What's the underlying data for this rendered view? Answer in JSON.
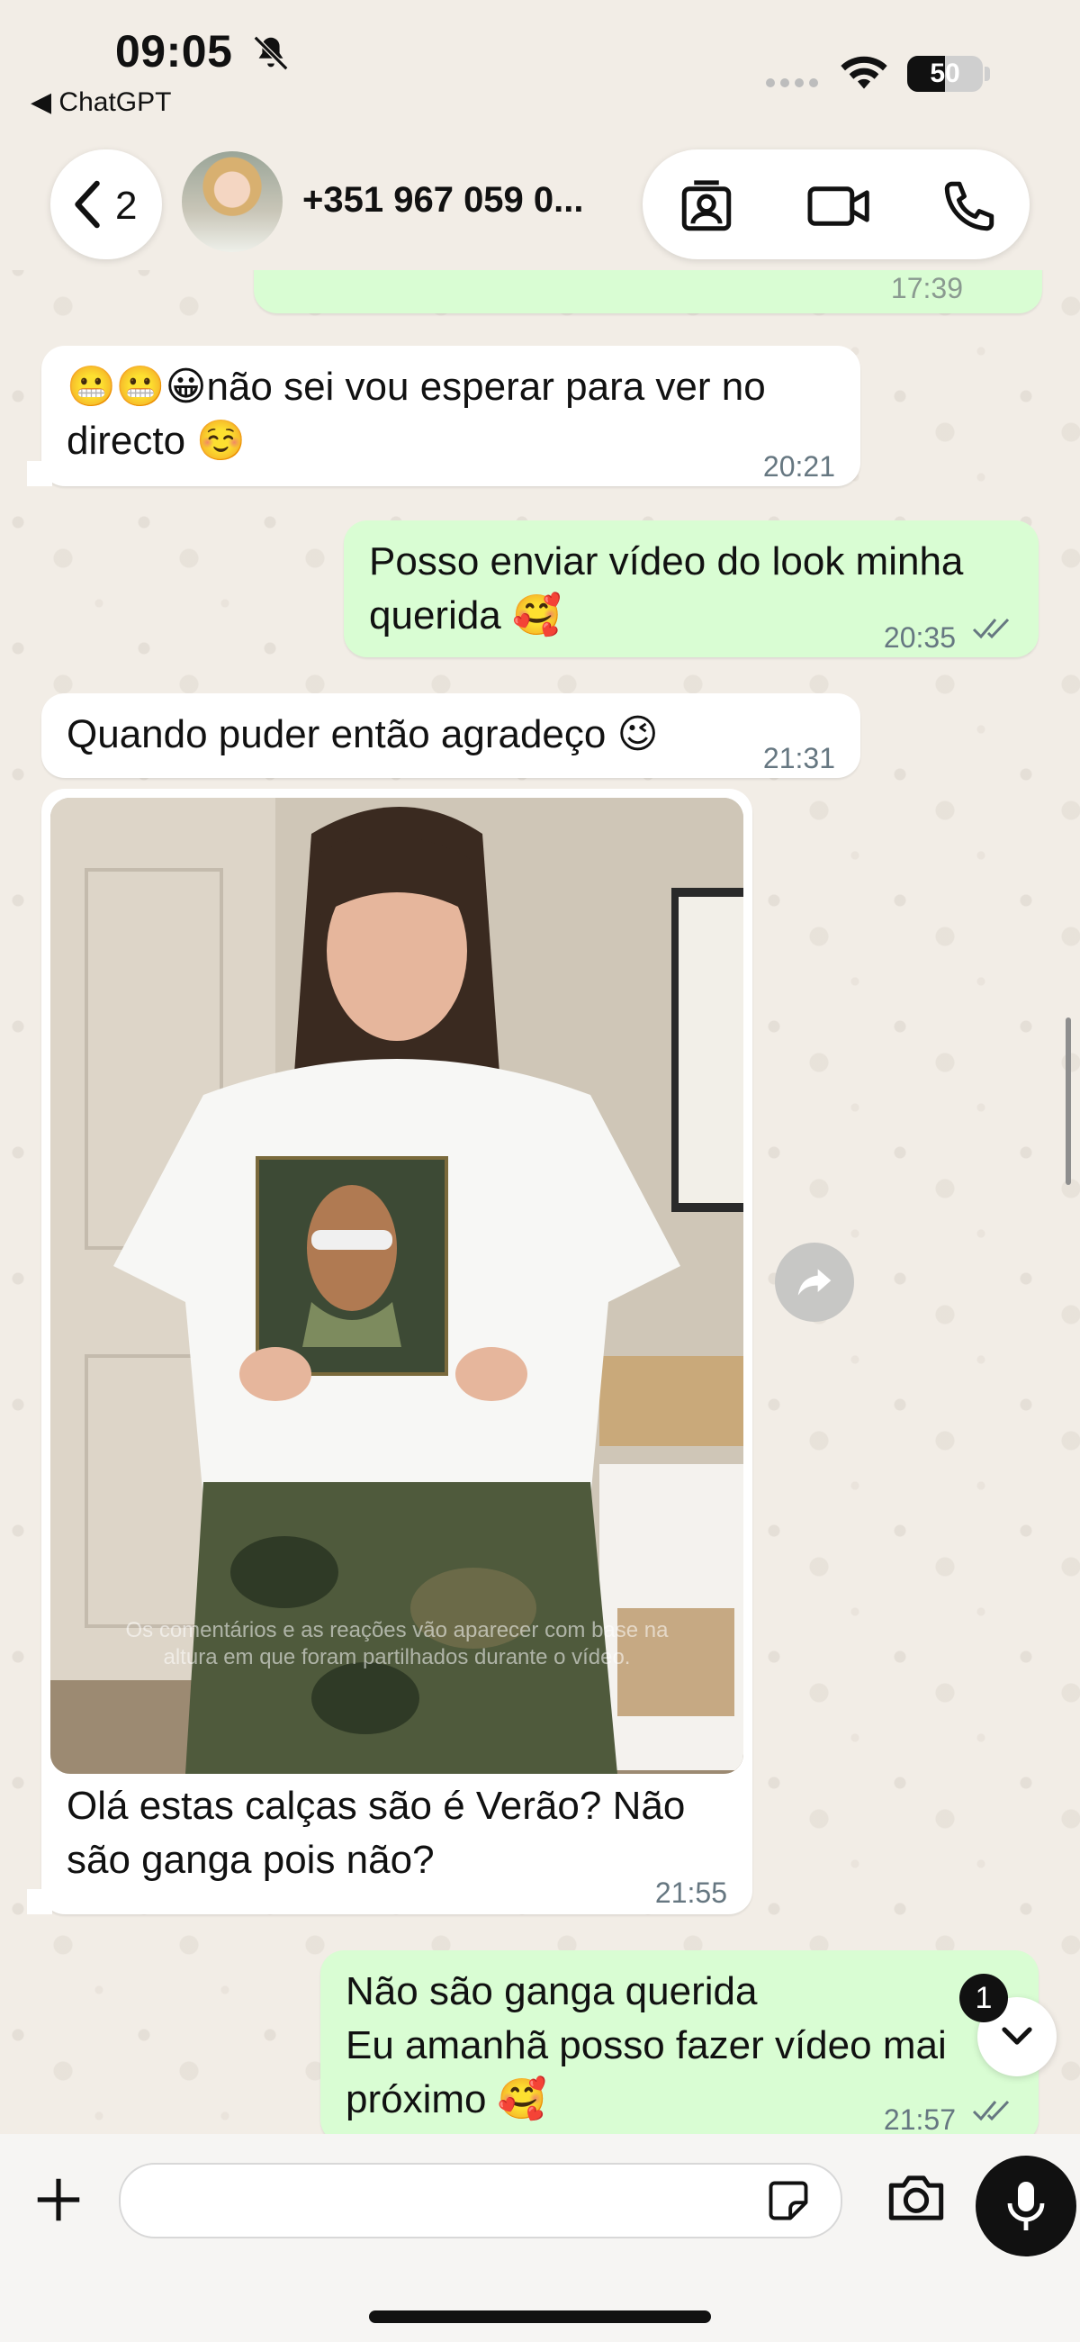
{
  "status_bar": {
    "time": "09:05",
    "back_app": "◀ ChatGPT",
    "battery_level": "50",
    "battery_fraction": 0.5
  },
  "header": {
    "back_count": "2",
    "contact_name": "+351 967 059 0..."
  },
  "messages": [
    {
      "id": "m1",
      "direction": "incoming",
      "text": "😬😬😀não sei vou esperar para ver no\ndirecto ☺️",
      "time": "20:21"
    },
    {
      "id": "m2",
      "direction": "outgoing",
      "text": "Posso enviar vídeo do look minha\nquerida 🥰",
      "time": "20:35"
    },
    {
      "id": "m3",
      "direction": "incoming",
      "text": "Quando puder então agradeço 😉",
      "time": "21:31"
    },
    {
      "id": "m4",
      "direction": "incoming",
      "type": "video",
      "overlay_text": "Os comentários e as reações vão aparecer com base na\naltura em que foram partilhados durante o vídeo.",
      "text": "Olá estas calças são é Verão? Não\nsão ganga pois não?",
      "time": "21:55"
    },
    {
      "id": "m5",
      "direction": "outgoing",
      "text": "Não são ganga querida\nEu amanhã posso fazer vídeo mai\npróximo 🥰",
      "time": "21:57"
    }
  ],
  "previous_message_time": "17:39",
  "unread_count": "1",
  "input": {
    "value": "",
    "placeholder": ""
  },
  "icons": [
    "bell-off-icon",
    "wifi-icon",
    "battery-icon",
    "chevron-left-icon",
    "contact-card-icon",
    "video-call-icon",
    "phone-icon",
    "double-check-icon",
    "forward-icon",
    "chevron-down-icon",
    "plus-icon",
    "sticker-icon",
    "camera-icon",
    "microphone-icon"
  ],
  "colors": {
    "outgoing_bubble": "#d9fdd3",
    "incoming_bubble": "#ffffff",
    "read_ticks": "#667781",
    "wallpaper": "#f2ede6"
  }
}
